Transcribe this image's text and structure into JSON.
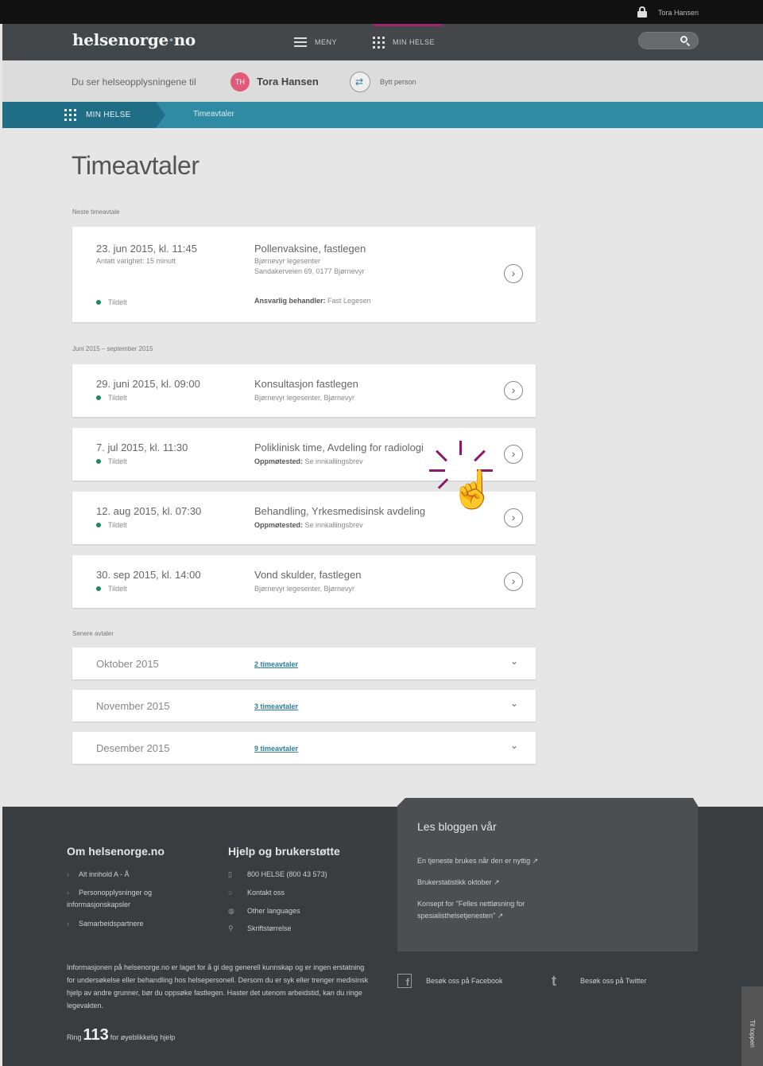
{
  "topbar": {
    "username": "Tora Hansen"
  },
  "header": {
    "logo": "helsenorge",
    "logo_dot": "·",
    "logo_tld": "no",
    "menu_label": "MENY",
    "minhelse_label": "MIN HELSE"
  },
  "infobar": {
    "text": "Du ser helseopplysningene til",
    "avatar_initials": "TH",
    "person_name": "Tora Hansen",
    "swap_label": "Bytt person"
  },
  "breadcrumb": {
    "home": "MIN HELSE",
    "current": "Timeavtaler"
  },
  "page": {
    "title": "Timeavtaler",
    "next_label": "Neste timeavtale",
    "range_label": "Juni 2015 – september 2015",
    "later_label": "Senere avtaler"
  },
  "next_appointment": {
    "date": "23. jun 2015, kl. 11:45",
    "duration": "Antatt varighet: 15 minutt",
    "status": "Tildelt",
    "title": "Pollenvaksine, fastlegen",
    "line1": "Bjørnevyr legesenter",
    "line2": "Sandakerveien 69, 0177 Bjørnevyr",
    "responsible_label": "Ansvarlig behandler:",
    "responsible_value": "Fast Legesen"
  },
  "appointments": [
    {
      "date": "29. juni 2015, kl. 09:00",
      "status": "Tildelt",
      "title": "Konsultasjon fastlegen",
      "sub_label": "",
      "sub_value": "Bjørnevyr legesenter, Bjørnevyr"
    },
    {
      "date": "7. jul 2015, kl. 11:30",
      "status": "Tildelt",
      "title": "Poliklinisk time, Avdeling for radiologi",
      "sub_label": "Oppmøtested:",
      "sub_value": "Se innkallingsbrev"
    },
    {
      "date": "12. aug 2015, kl. 07:30",
      "status": "Tildelt",
      "title": "Behandling, Yrkesmedisinsk avdeling",
      "sub_label": "Oppmøtested:",
      "sub_value": "Se innkallingsbrev"
    },
    {
      "date": "30. sep 2015, kl. 14:00",
      "status": "Tildelt",
      "title": "Vond skulder, fastlegen",
      "sub_label": "",
      "sub_value": "Bjørnevyr legesenter, Bjørnevyr"
    }
  ],
  "months": [
    {
      "name": "Oktober 2015",
      "count": "2 timeavtaler"
    },
    {
      "name": "November 2015",
      "count": "3 timeavtaler"
    },
    {
      "name": "Desember 2015",
      "count": "9 timeavtaler"
    }
  ],
  "footer": {
    "about_title": "Om helsenorge.no",
    "about_links": [
      "Alt innhold A - Å",
      "Personopplysninger og informasjonskapsler",
      "Samarbeidspartnere"
    ],
    "help_title": "Hjelp og brukerstøtte",
    "help_links": [
      "800 HELSE (800 43 573)",
      "Kontakt oss",
      "Other languages",
      "Skriftstørrelse"
    ],
    "blog_title": "Les bloggen vår",
    "blog_links": [
      "En tjeneste brukes når den er nyttig ↗",
      "Brukerstatistikk oktober ↗",
      "Konsept for \"Felles nettløsning for spesialisthelsetjenesten\" ↗"
    ],
    "disclaimer": "Informasjonen på helsenorge.no er laget for å gi deg generell kunnskap og er ingen erstatning for undersøkelse eller behandling hos helsepersonell. Dersom du er syk eller trenger medisinsk hjelp av andre grunner, bør du oppsøke fastlegen. Haster det utenom arbeidstid, kan du ringe legevakten.",
    "phone_prefix": "Ring",
    "phone_number": "113",
    "phone_suffix": "for øyeblikkelig hjelp",
    "facebook_label": "Besøk oss på Facebook",
    "twitter_label": "Besøk oss på Twitter",
    "side_tab": "Til toppen"
  },
  "colors": {
    "accent": "#a0266c",
    "teal": "#2f8aa3",
    "status_green": "#1a8a5a"
  }
}
